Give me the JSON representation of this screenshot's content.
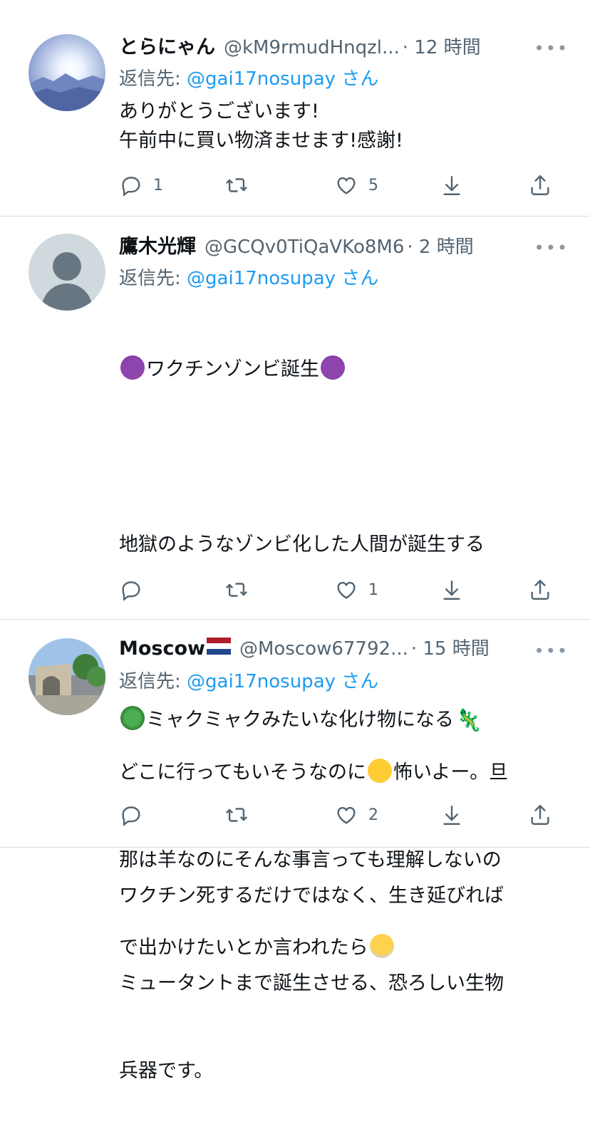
{
  "tweets": [
    {
      "name": "とらにゃん",
      "handle": "@kM9rmudHnqzl...",
      "time": "· 12 時間",
      "reply_prefix": "返信先: ",
      "reply_mention": "@gai17nosupay",
      "reply_suffix": " さん",
      "body_lines": [
        "ありがとうございます!",
        "午前中に買い物済ませます!感謝!"
      ],
      "replies": "1",
      "retweets": "",
      "likes": "5"
    },
    {
      "name": "鷹木光輝",
      "handle": "@GCQv0TiQaVKo8M6",
      "time": "· 2 時間",
      "reply_prefix": "返信先: ",
      "reply_mention": "@gai17nosupay",
      "reply_suffix": " さん",
      "line1": "ワクチンゾンビ誕生",
      "line2": "地獄のようなゾンビ化した人間が誕生する",
      "line3": "ミャクミャクみたいな化け物になる",
      "line4": "ワクチン死するだけではなく、生き延びれば",
      "line5": "ミュータントまで誕生させる、恐ろしい生物",
      "line6": "兵器です。",
      "replies": "",
      "retweets": "",
      "likes": "1"
    },
    {
      "name": "Moscow",
      "handle": "@Moscow67792...",
      "time": "· 15 時間",
      "reply_prefix": "返信先: ",
      "reply_mention": "@gai17nosupay",
      "reply_suffix": " さん",
      "line1a": "どこに行ってもいそうなのに",
      "line1b": "怖いよー。旦",
      "line2": "那は羊なのにそんな事言っても理解しないの",
      "line3": "で出かけたいとか言われたら",
      "replies": "",
      "retweets": "",
      "likes": "2"
    }
  ],
  "more_label": "•••",
  "colors": {
    "accent": "#1d9bf0",
    "muted": "#536471",
    "divider": "#d9dee2"
  },
  "icons": [
    "reply-icon",
    "retweet-icon",
    "like-icon",
    "download-icon",
    "share-icon",
    "more-icon"
  ]
}
